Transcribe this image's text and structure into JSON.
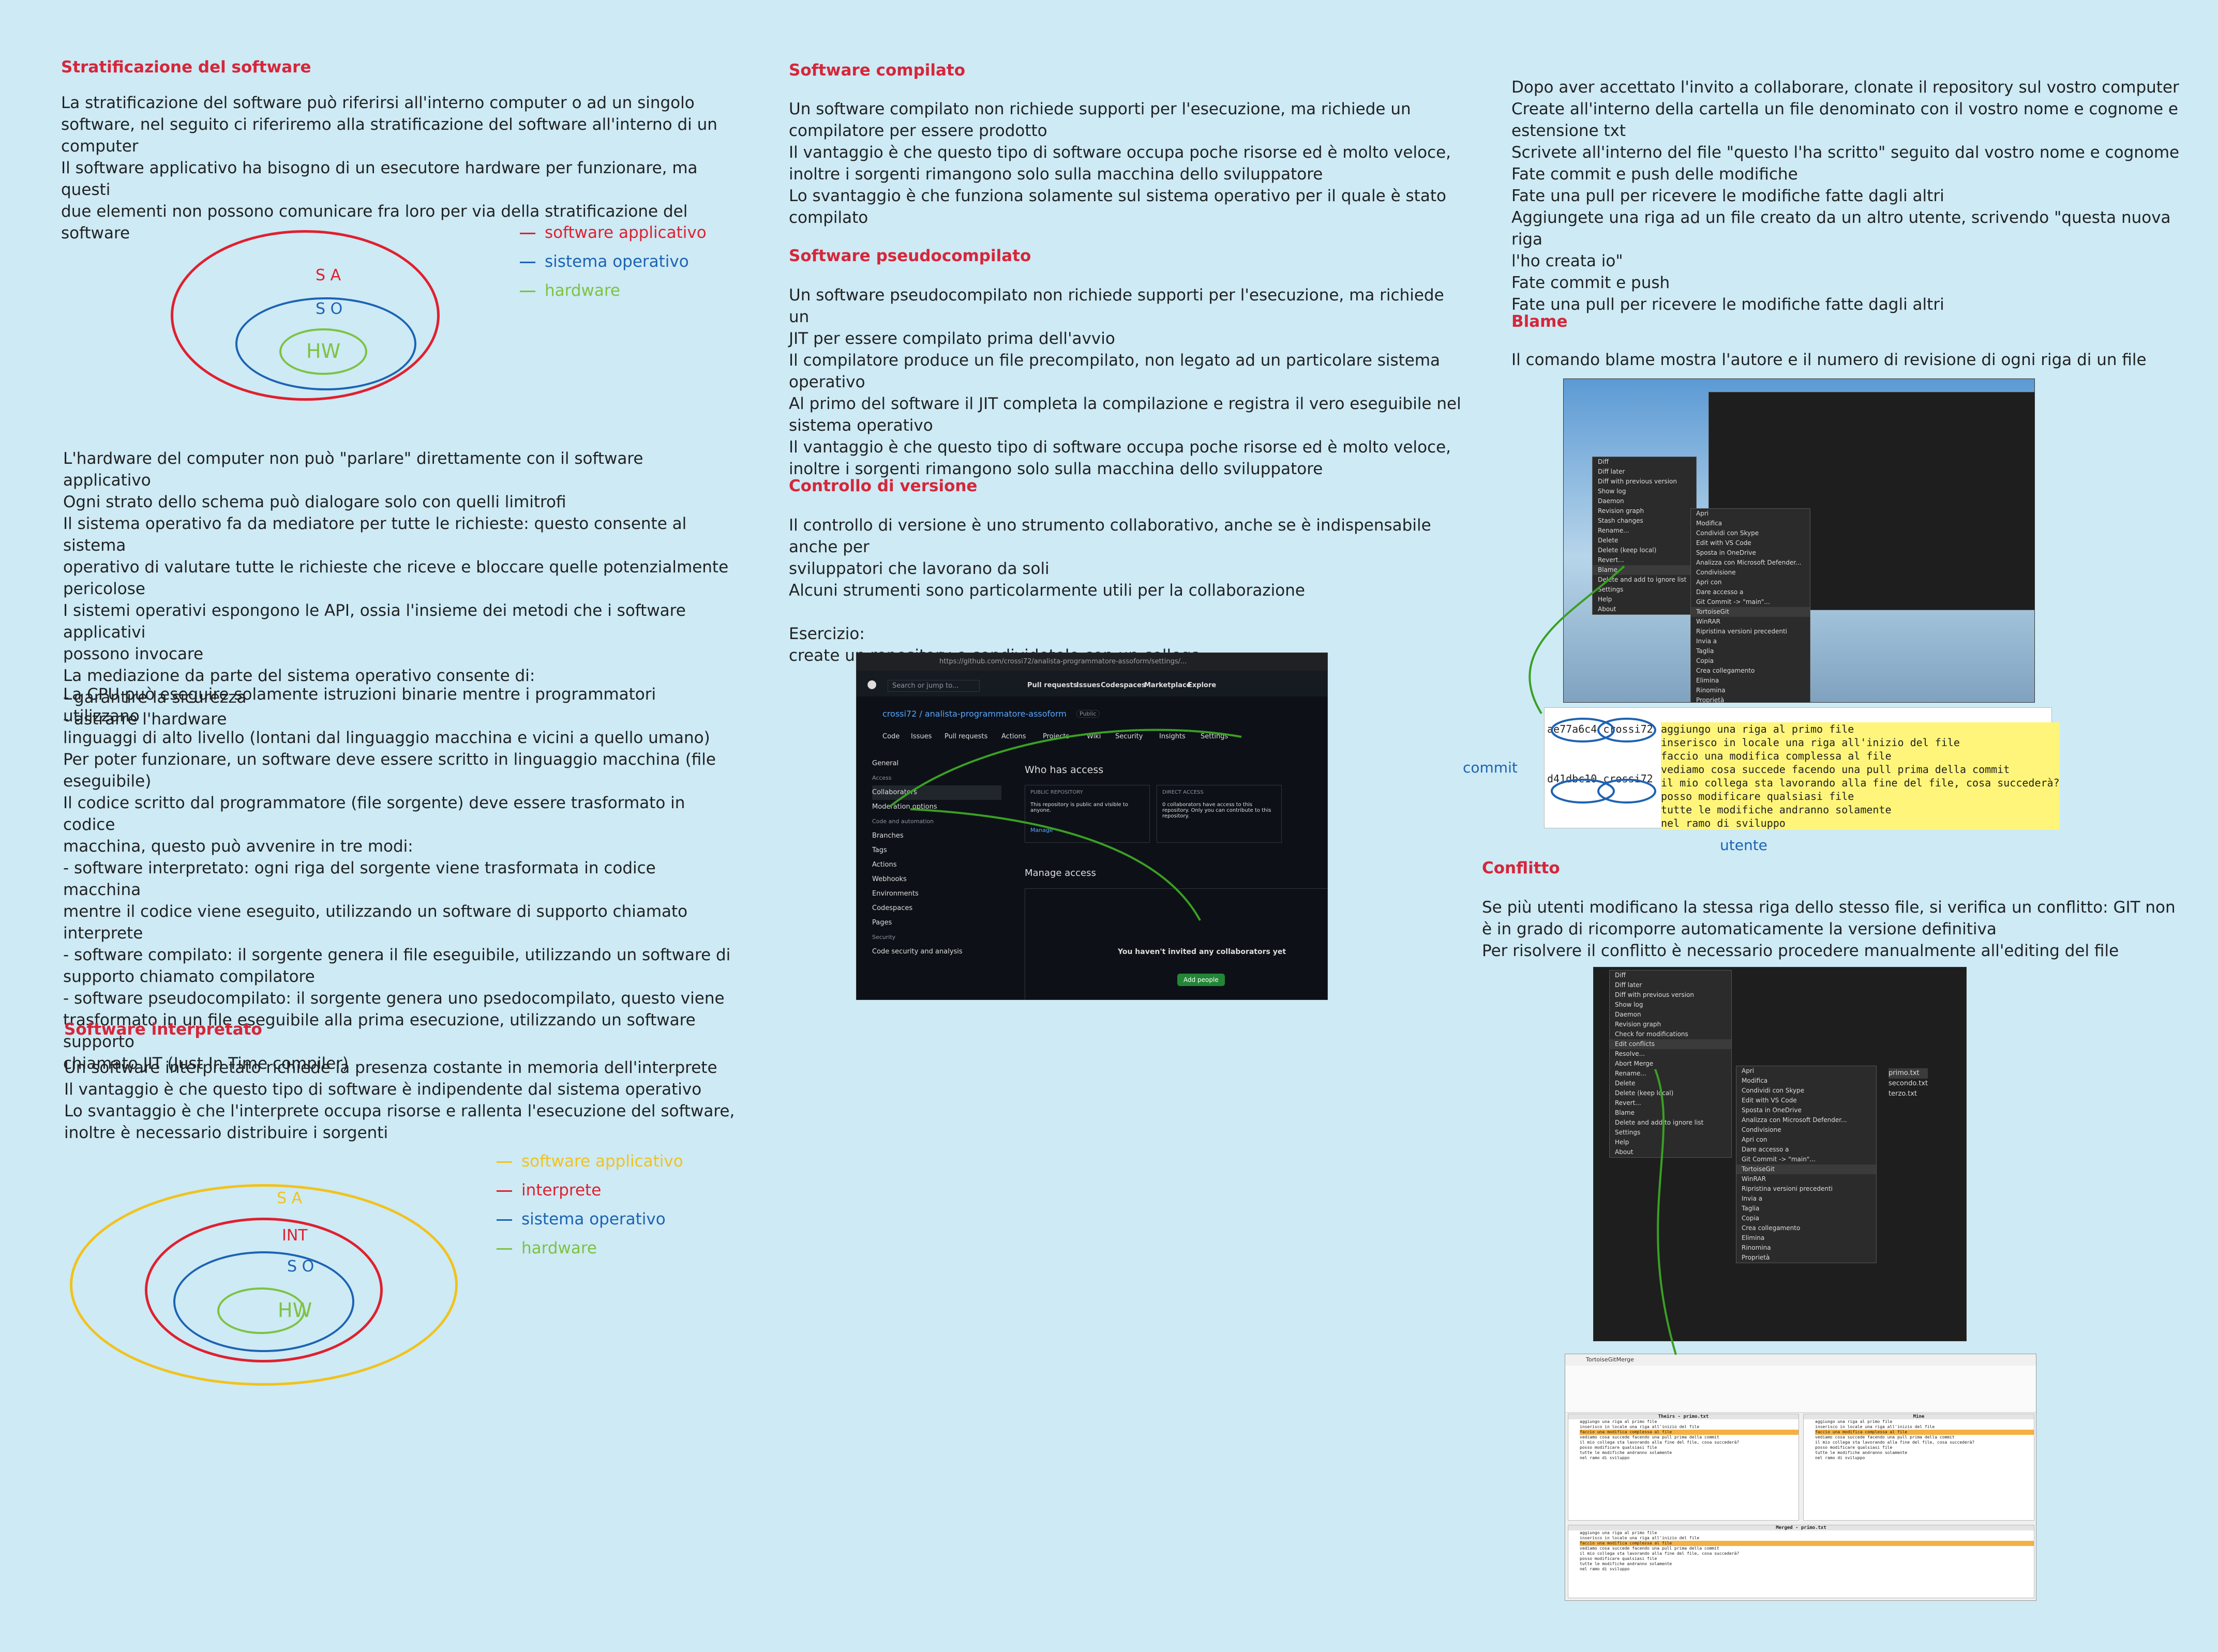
{
  "col1": {
    "title1": "Stratificazione del software",
    "p1": "La stratificazione del software può riferirsi all'interno computer o ad un singolo\nsoftware, nel seguito ci riferiremo alla stratificazione del software all'interno di un\ncomputer\nIl software applicativo ha bisogno di un esecutore hardware per funzionare, ma questi\ndue elementi non possono comunicare fra loro per via della stratificazione del software",
    "legend1": [
      "software applicativo",
      "sistema operativo",
      "hardware"
    ],
    "diagram1_labels": [
      "S A",
      "S O",
      "HW"
    ],
    "p2": "L'hardware del computer non può \"parlare\" direttamente con il software applicativo\nOgni strato dello schema può dialogare solo con quelli limitrofi\nIl sistema operativo fa da mediatore per tutte le richieste: questo consente al sistema\noperativo di valutare tutte le richieste che riceve e bloccare quelle potenzialmente\npericolose\nI sistemi operativi espongono le API, ossia l'insieme dei metodi che i software applicativi\npossono invocare\nLa mediazione da parte del sistema operativo consente di:\n- garantire la sicurezza\n- astrarre l'hardware",
    "p3": "La CPU può eseguire solamente istruzioni binarie mentre i programmatori utilizzano\nlinguaggi di alto livello (lontani dal linguaggio macchina e vicini a quello umano)\nPer poter funzionare, un software deve essere scritto in linguaggio macchina (file\neseguibile)\nIl codice scritto dal programmatore (file sorgente) deve essere trasformato in codice\nmacchina, questo può avvenire in tre modi:\n- software interpretato: ogni riga del sorgente viene trasformata in codice macchina\nmentre il codice viene eseguito, utilizzando un software di supporto chiamato interprete\n- software compilato: il sorgente genera il file eseguibile, utilizzando un software di\nsupporto chiamato compilatore\n- software pseudocompilato: il sorgente genera uno psedocompilato, questo viene\ntrasformato in un file eseguibile alla prima esecuzione, utilizzando un software supporto\nchiamato JIT (Just In Time compiler)",
    "title2": "Software interpretato",
    "p4": "Un software interpretato richiede la presenza costante in memoria dell'interprete\nIl vantaggio è che questo tipo di software è indipendente dal sistema operativo\nLo svantaggio è che l'interprete occupa risorse e rallenta l'esecuzione del software,\ninoltre è necessario distribuire i sorgenti",
    "legend2": [
      "software applicativo",
      "interprete",
      "sistema operativo",
      "hardware"
    ],
    "diagram2_labels": [
      "S A",
      "INT",
      "S O",
      "HW"
    ]
  },
  "col2": {
    "title1": "Software compilato",
    "p1": "Un software compilato non richiede supporti per l'esecuzione, ma richiede un\ncompilatore per essere prodotto\nIl vantaggio è che questo tipo di software occupa poche risorse ed è molto veloce,\ninoltre i sorgenti rimangono solo sulla macchina dello sviluppatore\nLo svantaggio è che funziona solamente sul sistema operativo per il quale è stato\ncompilato",
    "title2": "Software pseudocompilato",
    "p2": "Un software pseudocompilato non richiede supporti per l'esecuzione, ma richiede un\nJIT per essere compilato prima dell'avvio\nIl compilatore produce un file precompilato, non legato ad un particolare sistema\noperativo\nAl primo del software il JIT completa la compilazione e registra il vero eseguibile nel\nsistema operativo\nIl vantaggio è che questo tipo di software occupa poche risorse ed è molto veloce,\ninoltre i sorgenti rimangono solo sulla macchina dello sviluppatore",
    "title3": "Controllo di versione",
    "p3": "Il controllo di versione è uno strumento collaborativo, anche se è indispensabile anche per\nsviluppatori che lavorano da soli\nAlcuni strumenti sono particolarmente utili per la collaborazione\n\nEsercizio:\ncreate un repository e condividetelo con un collega",
    "github": {
      "url": "https://github.com/crossi72/analista-programmatore-assoform/settings/...",
      "search": "Search or jump to...",
      "nav": [
        "Pull requests",
        "Issues",
        "Codespaces",
        "Marketplace",
        "Explore"
      ],
      "repo": "crossi72 / analista-programmatore-assoform",
      "badge": "Public",
      "tabs": [
        "Code",
        "Issues",
        "Pull requests",
        "Actions",
        "Projects",
        "Wiki",
        "Security",
        "Insights",
        "Settings"
      ],
      "side": [
        "General",
        "Access",
        "Collaborators",
        "Moderation options",
        "Code and automation",
        "Branches",
        "Tags",
        "Actions",
        "Webhooks",
        "Environments",
        "Codespaces",
        "Pages",
        "Security",
        "Code security and analysis"
      ],
      "who": "Who has access",
      "public_repo": "PUBLIC REPOSITORY",
      "public_text": "This repository is public and visible to anyone.",
      "manage": "Manage",
      "direct": "DIRECT ACCESS",
      "direct_text": "0 collaborators have access to this repository. Only you can contribute to this repository.",
      "manage_access": "Manage access",
      "none": "You haven't invited any collaborators yet",
      "add": "Add people"
    }
  },
  "col3": {
    "p1": "Dopo aver accettato l'invito a collaborare, clonate il repository sul vostro computer\nCreate all'interno della cartella un file denominato con il vostro nome e cognome e\nestensione txt\nScrivete all'interno del file \"questo l'ha scritto\" seguito dal vostro nome e cognome\nFate commit e push delle modifiche\nFate una pull per ricevere le modifiche fatte dagli altri\nAggiungete una riga ad un file creato da un altro utente, scrivendo \"questa nuova riga\nl'ho creata io\"\nFate commit e push\nFate una pull per ricevere le modifiche fatte dagli altri",
    "title1": "Blame",
    "p2": "Il comando blame mostra l'autore e il numero di revisione di ogni riga di un file",
    "explorer_menu": [
      "Diff",
      "Diff later",
      "Diff with previous version",
      "Show log",
      "Daemon",
      "Revision graph",
      "Stash changes",
      "Rename...",
      "Delete",
      "Delete (keep local)",
      "Revert...",
      "Blame",
      "Delete and add to ignore list",
      "Settings",
      "Help",
      "About"
    ],
    "ctx_menu": [
      "Apri",
      "Modifica",
      "Condividi con Skype",
      "Edit with VS Code",
      "Sposta in OneDrive",
      "Analizza con Microsoft Defender...",
      "Condivisione",
      "Apri con",
      "Dare accesso a",
      "Git Commit -> \"main\"...",
      "TortoiseGit",
      "WinRAR",
      "Ripristina versioni precedenti",
      "Invia a",
      "Taglia",
      "Copia",
      "Crea collegamento",
      "Elimina",
      "Rinomina",
      "Proprietà"
    ],
    "blame": {
      "revs": [
        {
          "rev": "ae77a6c4",
          "author": "crossi72"
        },
        {
          "rev": "d41dbc10",
          "author": "crossi72"
        }
      ],
      "lines": [
        "aggiungo una riga al primo file",
        "inserisco in locale una riga all'inizio del file",
        "faccio una modifica complessa al file",
        "vediamo cosa succede facendo una pull prima della commit",
        "il mio collega sta lavorando alla fine del file, cosa succederà?",
        "posso modificare qualsiasi file",
        "tutte le modifiche andranno solamente",
        "nel ramo di sviluppo"
      ],
      "commit_label": "commit",
      "user_label": "utente"
    },
    "title2": "Conflitto",
    "p3": "Se più utenti modificano la stessa riga dello stesso file, si verifica un conflitto: GIT non\nè in grado di ricomporre automaticamente la versione definitiva\nPer risolvere il conflitto è necessario procedere manualmente all'editing del file",
    "conflict_menu": [
      "Diff",
      "Diff later",
      "Diff with previous version",
      "Show log",
      "Daemon",
      "Revision graph",
      "Check for modifications",
      "Edit conflicts",
      "Resolve...",
      "Abort Merge",
      "Rename...",
      "Delete",
      "Delete (keep local)",
      "Revert...",
      "Blame",
      "Delete and add to ignore list",
      "Settings",
      "Help",
      "About"
    ],
    "files": [
      "primo.txt",
      "secondo.txt",
      "terzo.txt"
    ],
    "merge": {
      "title": "TortoiseGitMerge",
      "left_title": "Theirs - primo.txt",
      "right_title": "Mine",
      "bottom_title": "Merged - primo.txt",
      "lines": [
        "aggiungo una riga al primo file",
        "inserisco in locale una riga all'inizio del file",
        "faccio una modifica complessa al file",
        "vediamo cosa succede facendo una pull prima della commit",
        "il mio collega sta lavorando alla fine del file, cosa succederà?",
        "posso modificare qualsiasi file",
        "tutte le modifiche andranno solamente",
        "nel ramo di sviluppo"
      ]
    }
  },
  "colors": {
    "background": "#cdeaf5",
    "heading": "#d6263a",
    "red": "#e0202e",
    "blue": "#1d63b3",
    "green": "#7ec241",
    "yellow": "#f2c21b",
    "annot": "#3aa023"
  }
}
